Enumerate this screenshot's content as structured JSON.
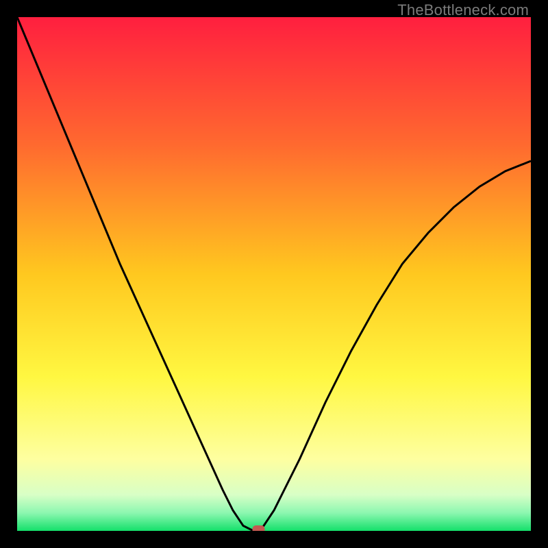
{
  "watermark": "TheBottleneck.com",
  "chart_data": {
    "type": "line",
    "title": "",
    "xlabel": "",
    "ylabel": "",
    "xlim": [
      0,
      100
    ],
    "ylim": [
      0,
      100
    ],
    "grid": false,
    "legend": false,
    "series": [
      {
        "name": "bottleneck-curve",
        "color": "#000000",
        "x": [
          0,
          5,
          10,
          15,
          20,
          25,
          30,
          35,
          40,
          42,
          44,
          46,
          47,
          48,
          50,
          55,
          60,
          65,
          70,
          75,
          80,
          85,
          90,
          95,
          100
        ],
        "y": [
          100,
          88,
          76,
          64,
          52,
          41,
          30,
          19,
          8,
          4,
          1,
          0,
          0,
          1,
          4,
          14,
          25,
          35,
          44,
          52,
          58,
          63,
          67,
          70,
          72
        ]
      }
    ],
    "marker": {
      "x": 47,
      "y": 0,
      "color": "#c45a52"
    },
    "background_gradient": {
      "stops": [
        {
          "offset": 0.0,
          "color": "#ff1f3f"
        },
        {
          "offset": 0.25,
          "color": "#ff6a2f"
        },
        {
          "offset": 0.5,
          "color": "#ffc81f"
        },
        {
          "offset": 0.7,
          "color": "#fff741"
        },
        {
          "offset": 0.86,
          "color": "#feffa0"
        },
        {
          "offset": 0.93,
          "color": "#d8ffc6"
        },
        {
          "offset": 0.965,
          "color": "#8cf7b0"
        },
        {
          "offset": 1.0,
          "color": "#14e06a"
        }
      ]
    }
  }
}
